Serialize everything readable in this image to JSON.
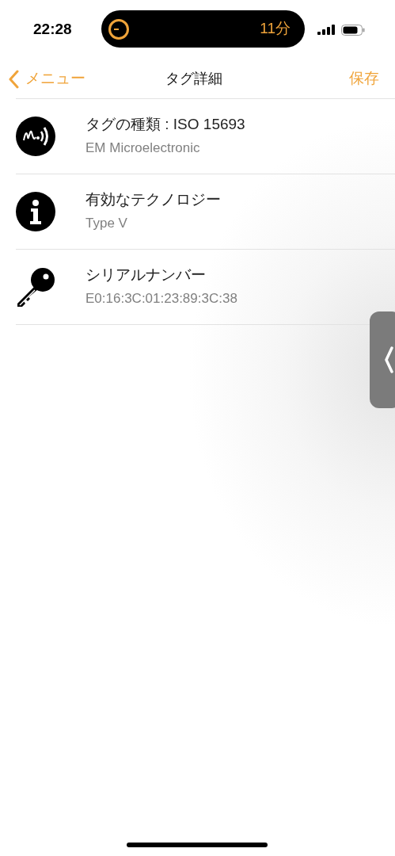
{
  "status_bar": {
    "time": "22:28",
    "activity": {
      "timer": "11分"
    }
  },
  "nav_bar": {
    "back": "メニュー",
    "title": "タグ詳細",
    "action": "保存"
  },
  "items": [
    {
      "kind": "nfc",
      "title": "タグの種類 : ISO 15693",
      "detail": "EM Microelectronic"
    },
    {
      "kind": "info",
      "title": "有効なテクノロジー",
      "detail": "Type V"
    },
    {
      "kind": "key",
      "title": "シリアルナンバー",
      "detail": "E0:16:3C:01:23:89:3C:38"
    }
  ]
}
